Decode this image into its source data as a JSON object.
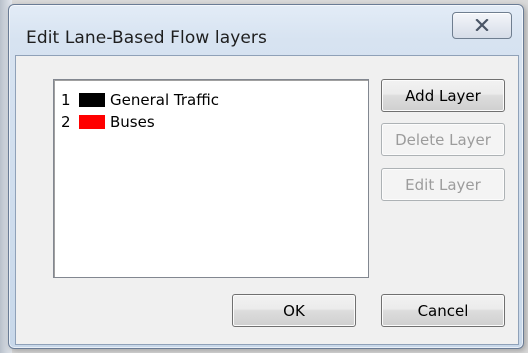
{
  "window": {
    "title": "Edit Lane-Based Flow layers"
  },
  "layers": [
    {
      "number": "1",
      "name": "General Traffic",
      "color": "#000000"
    },
    {
      "number": "2",
      "name": "Buses",
      "color": "#ff0000"
    }
  ],
  "buttons": {
    "add": "Add Layer",
    "delete": "Delete Layer",
    "edit": "Edit Layer",
    "ok": "OK",
    "cancel": "Cancel"
  },
  "states": {
    "delete_enabled": false,
    "edit_enabled": false
  },
  "icons": {
    "close": "close-x-icon"
  }
}
